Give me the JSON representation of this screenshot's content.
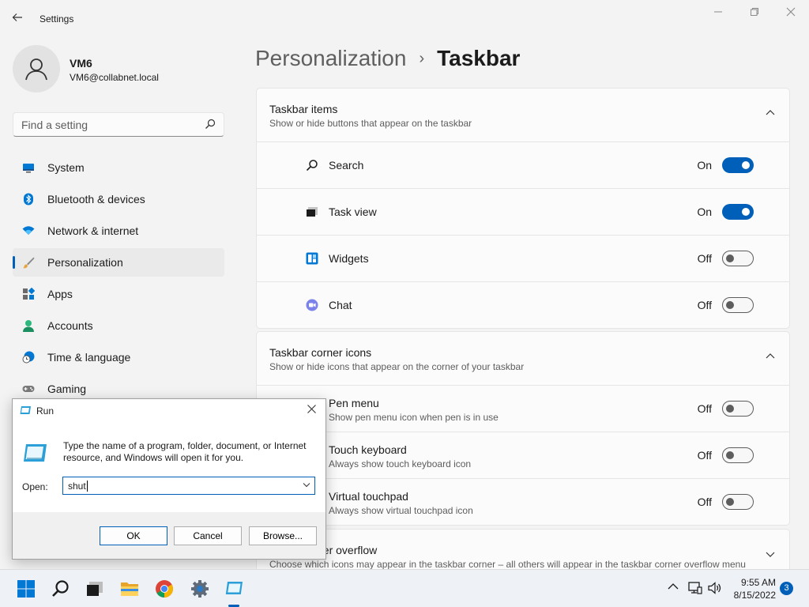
{
  "window": {
    "title": "Settings"
  },
  "user": {
    "name": "VM6",
    "email": "VM6@collabnet.local"
  },
  "search": {
    "placeholder": "Find a setting"
  },
  "sidebar": {
    "items": [
      {
        "label": "System",
        "icon": "system-icon"
      },
      {
        "label": "Bluetooth & devices",
        "icon": "bluetooth-icon"
      },
      {
        "label": "Network & internet",
        "icon": "wifi-icon"
      },
      {
        "label": "Personalization",
        "icon": "brush-icon",
        "active": true
      },
      {
        "label": "Apps",
        "icon": "apps-icon"
      },
      {
        "label": "Accounts",
        "icon": "accounts-icon"
      },
      {
        "label": "Time & language",
        "icon": "clock-globe-icon"
      },
      {
        "label": "Gaming",
        "icon": "gamepad-icon"
      }
    ]
  },
  "breadcrumb": {
    "parent": "Personalization",
    "separator": "›",
    "current": "Taskbar"
  },
  "taskbar_items": {
    "title": "Taskbar items",
    "subtitle": "Show or hide buttons that appear on the taskbar",
    "rows": [
      {
        "label": "Search",
        "state": "On"
      },
      {
        "label": "Task view",
        "state": "On"
      },
      {
        "label": "Widgets",
        "state": "Off"
      },
      {
        "label": "Chat",
        "state": "Off"
      }
    ]
  },
  "corner_icons": {
    "title": "Taskbar corner icons",
    "subtitle": "Show or hide icons that appear on the corner of your taskbar",
    "rows": [
      {
        "label": "Pen menu",
        "desc": "Show pen menu icon when pen is in use",
        "state": "Off"
      },
      {
        "label": "Touch keyboard",
        "desc": "Always show touch keyboard icon",
        "state": "Off"
      },
      {
        "label": "Virtual touchpad",
        "desc": "Always show virtual touchpad icon",
        "state": "Off"
      }
    ]
  },
  "overflow": {
    "title": "ner overflow",
    "subtitle": "Choose which icons may appear in the taskbar corner – all others will appear in the taskbar corner overflow menu"
  },
  "run_dialog": {
    "title": "Run",
    "description": "Type the name of a program, folder, document, or Internet resource, and Windows will open it for you.",
    "open_label": "Open:",
    "value": "shut",
    "ok": "OK",
    "cancel": "Cancel",
    "browse": "Browse..."
  },
  "system_tray": {
    "time": "9:55 AM",
    "date": "8/15/2022",
    "notifications": "3"
  },
  "colors": {
    "accent": "#005fb8",
    "background": "#f3f3f3",
    "card": "#fbfbfb"
  }
}
